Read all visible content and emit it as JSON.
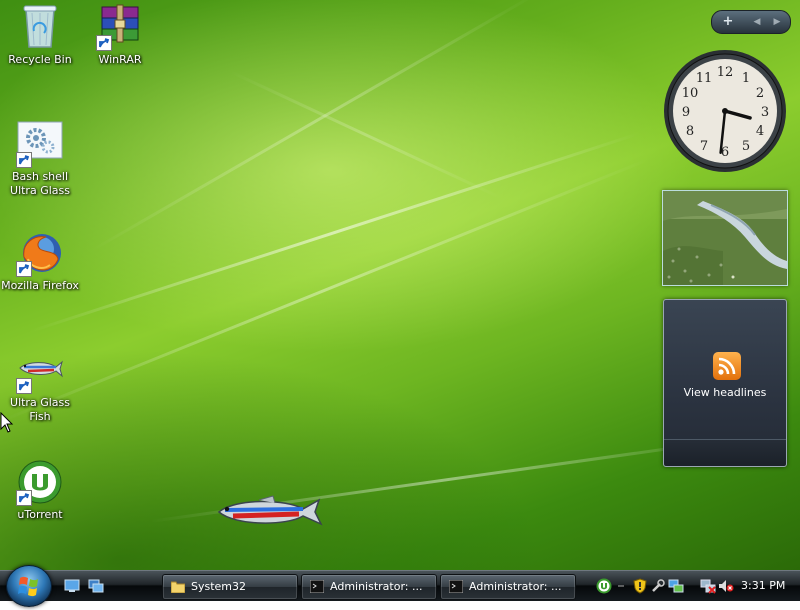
{
  "desktop_icons": [
    {
      "label": "Recycle Bin"
    },
    {
      "label": "WinRAR"
    },
    {
      "label": "Bash shell Ultra Glass"
    },
    {
      "label": "Mozilla Firefox"
    },
    {
      "label": "Ultra Glass Fish"
    },
    {
      "label": "uTorrent"
    }
  ],
  "sidebar": {
    "add_symbol": "+",
    "prev_symbol": "◀",
    "next_symbol": "▶",
    "clock_time": "3:31",
    "clock_numerals": [
      "12",
      "1",
      "2",
      "3",
      "4",
      "5",
      "6",
      "7",
      "8",
      "9",
      "10",
      "11"
    ],
    "feed_label": "View headlines"
  },
  "taskbar": {
    "tasks": [
      {
        "label": "System32",
        "icon": "folder-icon"
      },
      {
        "label": "Administrator: ...",
        "icon": "console-icon"
      },
      {
        "label": "Administrator: ...",
        "icon": "console-icon"
      }
    ],
    "clock": "3:31 PM"
  },
  "colors": {
    "accent": "#7cc22a",
    "taskbar": "#1b2024",
    "rss": "#f08a1e"
  }
}
